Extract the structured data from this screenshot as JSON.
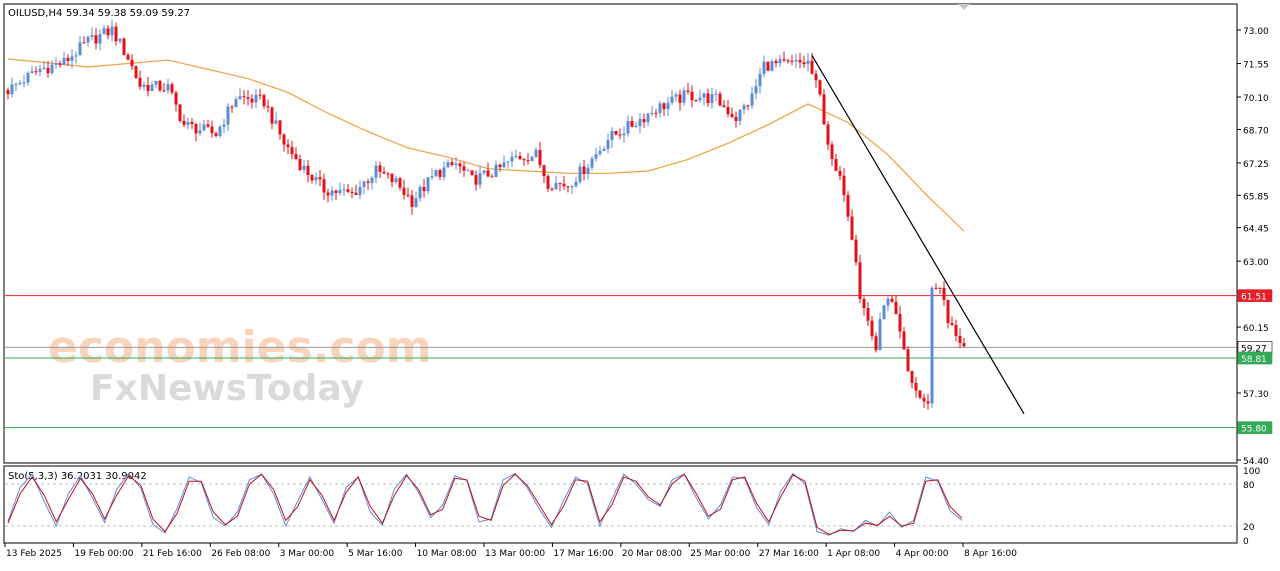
{
  "header": {
    "symbol": "OILUSD,H4",
    "ohlc": "59.34 59.38 59.09 59.27"
  },
  "watermark": {
    "line1": "economies.com",
    "line2": "FxNewsToday"
  },
  "colors": {
    "bull": "#5b8dd6",
    "bear": "#e3101a",
    "ma": "#f0a040",
    "trendline": "#000000",
    "resistance": "#e3202a",
    "support": "#33aa55",
    "current": "#9a9a9a",
    "stoch_main": "#5b8dd6",
    "stoch_signal": "#c0101a"
  },
  "chart_data": [
    {
      "type": "candlestick",
      "title": "OILUSD,H4",
      "ylim": [
        54.4,
        73.0
      ],
      "y_ticks": [
        "73.00",
        "71.55",
        "70.10",
        "68.70",
        "67.25",
        "65.85",
        "64.45",
        "63.00",
        "60.15",
        "57.30",
        "54.40"
      ],
      "x_ticks": [
        "13 Feb 2025",
        "19 Feb 00:00",
        "21 Feb 16:00",
        "26 Feb 08:00",
        "3 Mar 00:00",
        "5 Mar 16:00",
        "10 Mar 08:00",
        "13 Mar 00:00",
        "17 Mar 16:00",
        "20 Mar 08:00",
        "25 Mar 00:00",
        "27 Mar 16:00",
        "1 Apr 08:00",
        "4 Apr 00:00",
        "8 Apr 16:00"
      ],
      "horizontal_levels": [
        {
          "label": "61.51",
          "value": 61.51,
          "kind": "resistance"
        },
        {
          "label": "59.27",
          "value": 59.27,
          "kind": "current"
        },
        {
          "label": "58.81",
          "value": 58.81,
          "kind": "support"
        },
        {
          "label": "55.80",
          "value": 55.8,
          "kind": "support"
        }
      ],
      "trendline": {
        "from": {
          "bar": 201,
          "price": 71.9
        },
        "to": {
          "bar": 254,
          "price": 56.4
        }
      },
      "moving_average_path": [
        [
          0,
          71.75
        ],
        [
          20,
          71.4
        ],
        [
          40,
          71.7
        ],
        [
          60,
          70.9
        ],
        [
          70,
          70.3
        ],
        [
          80,
          69.4
        ],
        [
          90,
          68.6
        ],
        [
          100,
          67.9
        ],
        [
          110,
          67.5
        ],
        [
          120,
          67.0
        ],
        [
          130,
          66.9
        ],
        [
          140,
          66.8
        ],
        [
          150,
          66.8
        ],
        [
          160,
          66.9
        ],
        [
          170,
          67.4
        ],
        [
          180,
          68.1
        ],
        [
          190,
          68.9
        ],
        [
          200,
          69.8
        ],
        [
          210,
          69.0
        ],
        [
          220,
          67.6
        ],
        [
          230,
          65.8
        ],
        [
          239,
          64.3
        ]
      ],
      "ohlc_path": [
        [
          0,
          70.4
        ],
        [
          8,
          71.3
        ],
        [
          14,
          71.6
        ],
        [
          20,
          72.5
        ],
        [
          26,
          73.0
        ],
        [
          30,
          71.8
        ],
        [
          33,
          70.6
        ],
        [
          40,
          70.5
        ],
        [
          44,
          68.9
        ],
        [
          52,
          68.5
        ],
        [
          57,
          70.1
        ],
        [
          64,
          69.9
        ],
        [
          69,
          68.1
        ],
        [
          74,
          67.0
        ],
        [
          79,
          66.1
        ],
        [
          86,
          65.9
        ],
        [
          92,
          66.9
        ],
        [
          97,
          66.4
        ],
        [
          101,
          65.6
        ],
        [
          107,
          66.8
        ],
        [
          112,
          67.2
        ],
        [
          116,
          66.5
        ],
        [
          122,
          66.9
        ],
        [
          127,
          67.5
        ],
        [
          132,
          67.6
        ],
        [
          135,
          66.4
        ],
        [
          140,
          66.3
        ],
        [
          145,
          67.2
        ],
        [
          150,
          68.3
        ],
        [
          156,
          68.9
        ],
        [
          162,
          69.6
        ],
        [
          170,
          70.2
        ],
        [
          177,
          70.0
        ],
        [
          182,
          69.2
        ],
        [
          186,
          70.1
        ],
        [
          189,
          71.5
        ],
        [
          195,
          71.5
        ],
        [
          200,
          71.6
        ],
        [
          203,
          70.1
        ],
        [
          206,
          67.2
        ],
        [
          209,
          66.1
        ],
        [
          212,
          63.2
        ],
        [
          213,
          61.5
        ],
        [
          215,
          60.4
        ],
        [
          217,
          59.2
        ],
        [
          219,
          61.3
        ],
        [
          221,
          61.1
        ],
        [
          223,
          59.8
        ],
        [
          225,
          58.2
        ],
        [
          227,
          57.4
        ],
        [
          229,
          56.8
        ],
        [
          230,
          57.0
        ],
        [
          231,
          61.8
        ],
        [
          233,
          62.0
        ],
        [
          235,
          60.3
        ],
        [
          237,
          59.9
        ],
        [
          239,
          59.27
        ]
      ]
    },
    {
      "type": "line",
      "title": "Sto(5,3,3) 36.2031 30.9042",
      "ylim": [
        0,
        100
      ],
      "y_ticks": [
        "100",
        "80",
        "20",
        "0"
      ],
      "levels": [
        80,
        20
      ],
      "series": [
        {
          "name": "Main",
          "values": [
            27,
            75,
            94,
            55,
            20,
            66,
            92,
            60,
            25,
            72,
            95,
            74,
            22,
            10,
            45,
            90,
            82,
            32,
            20,
            40,
            86,
            94,
            66,
            20,
            56,
            90,
            58,
            24,
            75,
            90,
            40,
            21,
            73,
            94,
            68,
            32,
            50,
            92,
            85,
            26,
            30,
            86,
            95,
            75,
            44,
            18,
            56,
            90,
            80,
            20,
            58,
            94,
            80,
            58,
            48,
            86,
            94,
            60,
            30,
            50,
            90,
            88,
            46,
            22,
            70,
            95,
            80,
            12,
            7,
            16,
            12,
            28,
            20,
            40,
            18,
            28,
            90,
            84,
            42,
            28
          ]
        },
        {
          "name": "Signal",
          "values": [
            24,
            66,
            90,
            64,
            26,
            58,
            88,
            66,
            30,
            64,
            92,
            78,
            30,
            12,
            38,
            84,
            84,
            40,
            22,
            34,
            80,
            94,
            72,
            28,
            48,
            86,
            64,
            28,
            68,
            90,
            48,
            24,
            64,
            92,
            72,
            36,
            44,
            88,
            86,
            34,
            28,
            78,
            94,
            78,
            50,
            22,
            48,
            86,
            84,
            26,
            50,
            90,
            84,
            62,
            50,
            80,
            94,
            66,
            34,
            44,
            86,
            90,
            52,
            26,
            62,
            93,
            84,
            18,
            8,
            14,
            13,
            24,
            21,
            34,
            20,
            24,
            84,
            86,
            48,
            31
          ]
        }
      ]
    }
  ]
}
